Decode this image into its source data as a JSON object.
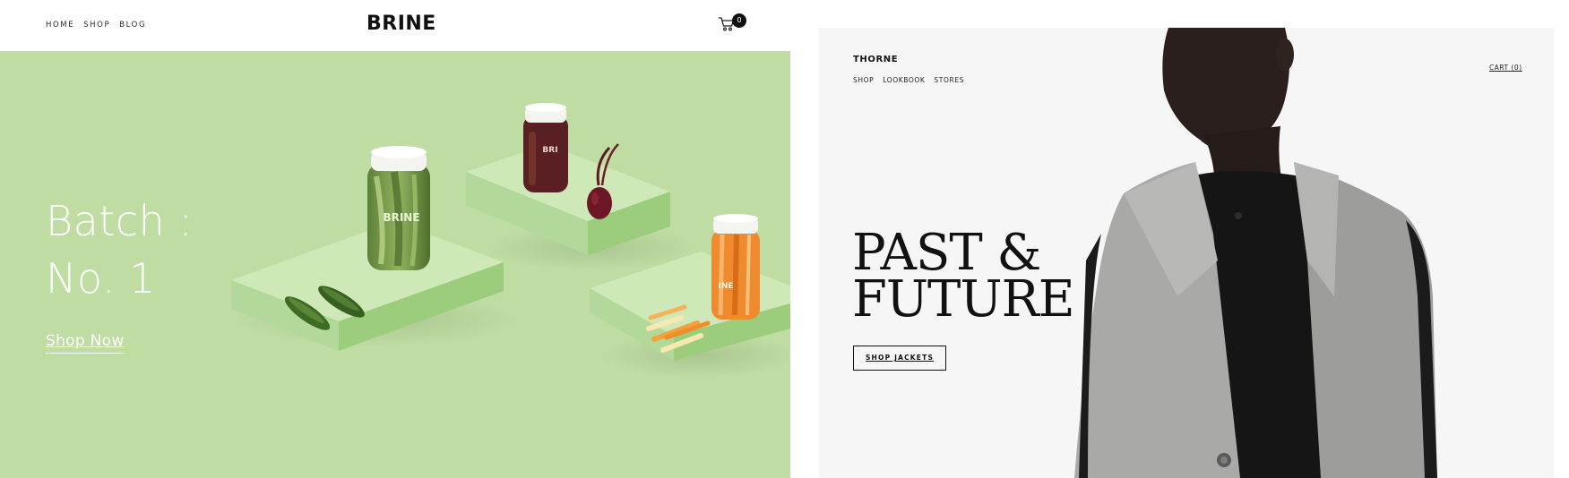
{
  "brine": {
    "nav": [
      "HOME",
      "SHOP",
      "BLOG"
    ],
    "logo": "BRINE",
    "cart_count": "0",
    "hero": {
      "title_line1": "Batch :",
      "title_line2": "No. 1",
      "cta": "Shop Now",
      "jar_label": "BRINE"
    },
    "colors": {
      "hero_bg": "#bfdca2",
      "block_top": "#cfe8b7",
      "block_side": "#9ccd7c"
    }
  },
  "thorne": {
    "logo": "THORNE",
    "nav": [
      "SHOP",
      "LOOKBOOK",
      "STORES"
    ],
    "cart": "CART (0)",
    "headline_line1": "PAST &",
    "headline_line2": "FUTURE",
    "cta": "SHOP JACKETS",
    "colors": {
      "bg": "#f6f6f6",
      "jacket": "#a9aaa8"
    }
  },
  "icons": [
    "cart-icon"
  ]
}
